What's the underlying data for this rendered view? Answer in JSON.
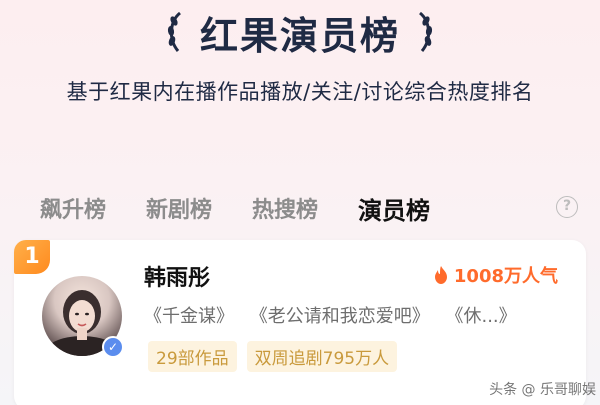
{
  "header": {
    "title": "红果演员榜",
    "subtitle": "基于红果内在播作品播放/关注/讨论综合热度排名"
  },
  "tabs": [
    {
      "label": "飙升榜",
      "active": false
    },
    {
      "label": "新剧榜",
      "active": false
    },
    {
      "label": "热搜榜",
      "active": false
    },
    {
      "label": "演员榜",
      "active": true
    }
  ],
  "help_icon": {
    "symbol": "?"
  },
  "list": [
    {
      "rank": "1",
      "name": "韩雨彤",
      "popularity": "1008万人气",
      "works": [
        "《千金谋》",
        "《老公请和我恋爱吧》",
        "《休...》"
      ],
      "tags": [
        "29部作品",
        "双周追剧795万人"
      ],
      "verified": true
    }
  ],
  "watermark": "头条 @ 乐哥聊娱",
  "colors": {
    "accent_orange": "#ff6b2c",
    "tag_bg": "#fdf3df",
    "tag_text": "#c99a3c",
    "title_text": "#1f2a44"
  }
}
